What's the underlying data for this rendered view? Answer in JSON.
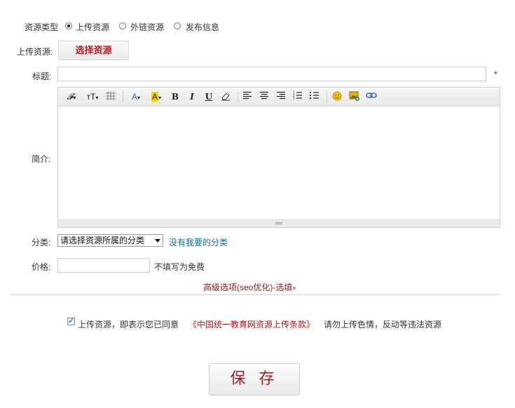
{
  "resource_type": {
    "label": "资源类型",
    "options": [
      {
        "label": "上传资源",
        "checked": true
      },
      {
        "label": "外链资源",
        "checked": false
      },
      {
        "label": "发布信息",
        "checked": false
      }
    ]
  },
  "upload": {
    "label": "上传资源:",
    "button": "选择资源"
  },
  "title_field": {
    "label": "标题:",
    "value": "",
    "required_mark": "*"
  },
  "intro": {
    "label": "简介:",
    "toolbar": {
      "font_family": "𝓕",
      "font_size": "ᴛT",
      "font_color": "A",
      "bg_color": "A",
      "bold": "B",
      "italic": "I",
      "underline": "U"
    }
  },
  "category": {
    "label": "分类:",
    "selected": "请选择资源所属的分类",
    "missing_link": "没有我要的分类"
  },
  "price": {
    "label": "价格:",
    "value": "",
    "hint": "不填写为免费"
  },
  "advanced": {
    "label": "高级选项(seo优化)-选填",
    "chevron": "»"
  },
  "agreement": {
    "checked": true,
    "prefix": "上传资源，即表示您已同意",
    "terms_link": "《中国统一教育网资源上传条款》",
    "warning": "请勿上传色情，反动等违法资源"
  },
  "save_button": "保 存",
  "colors": {
    "accent_red": "#c0171d",
    "link_teal": "#14698b",
    "advanced_red": "#8b1a1a"
  }
}
